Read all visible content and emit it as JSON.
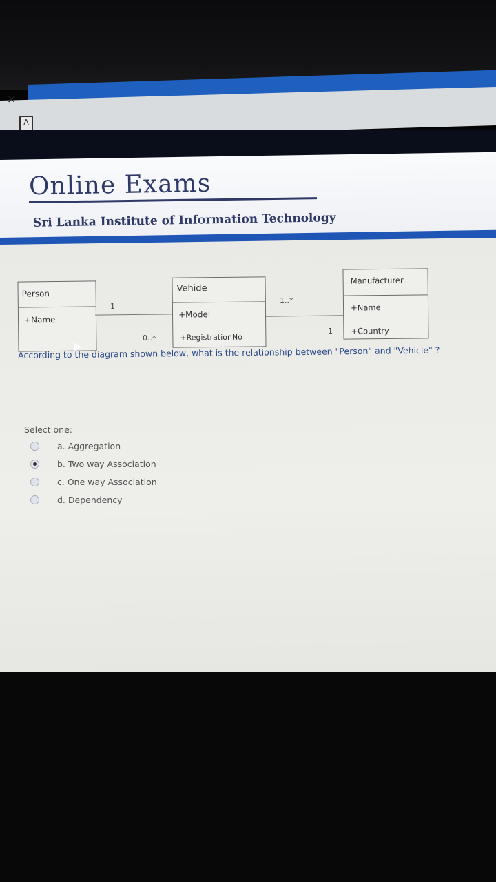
{
  "browser": {
    "close_glyph": "×",
    "tab_icon": "A"
  },
  "header": {
    "title": "Online Exams",
    "subtitle": "Sri Lanka Institute of Information Technology"
  },
  "diagram": {
    "person": {
      "name": "Person",
      "attr": "+Name"
    },
    "vehicle": {
      "name": "Vehide",
      "attrs": [
        "+Model",
        "+RegistrationNo"
      ]
    },
    "manufacturer": {
      "name": "Manufacturer",
      "attrs": [
        "+Name",
        "+Country"
      ]
    },
    "multiplicities": {
      "person_side": "1",
      "vehicle_side_person": "0..*",
      "vehicle_side_mfr": "1..*",
      "mfr_side": "1"
    }
  },
  "question": {
    "text": "According to the diagram shown below, what is the relationship between \"Person\" and \"Vehicle\" ?",
    "select_label": "Select one:",
    "options": [
      {
        "label": "a. Aggregation",
        "selected": false
      },
      {
        "label": "b. Two way Association",
        "selected": true
      },
      {
        "label": "c. One way Association",
        "selected": false
      },
      {
        "label": "d. Dependency",
        "selected": false
      }
    ]
  }
}
